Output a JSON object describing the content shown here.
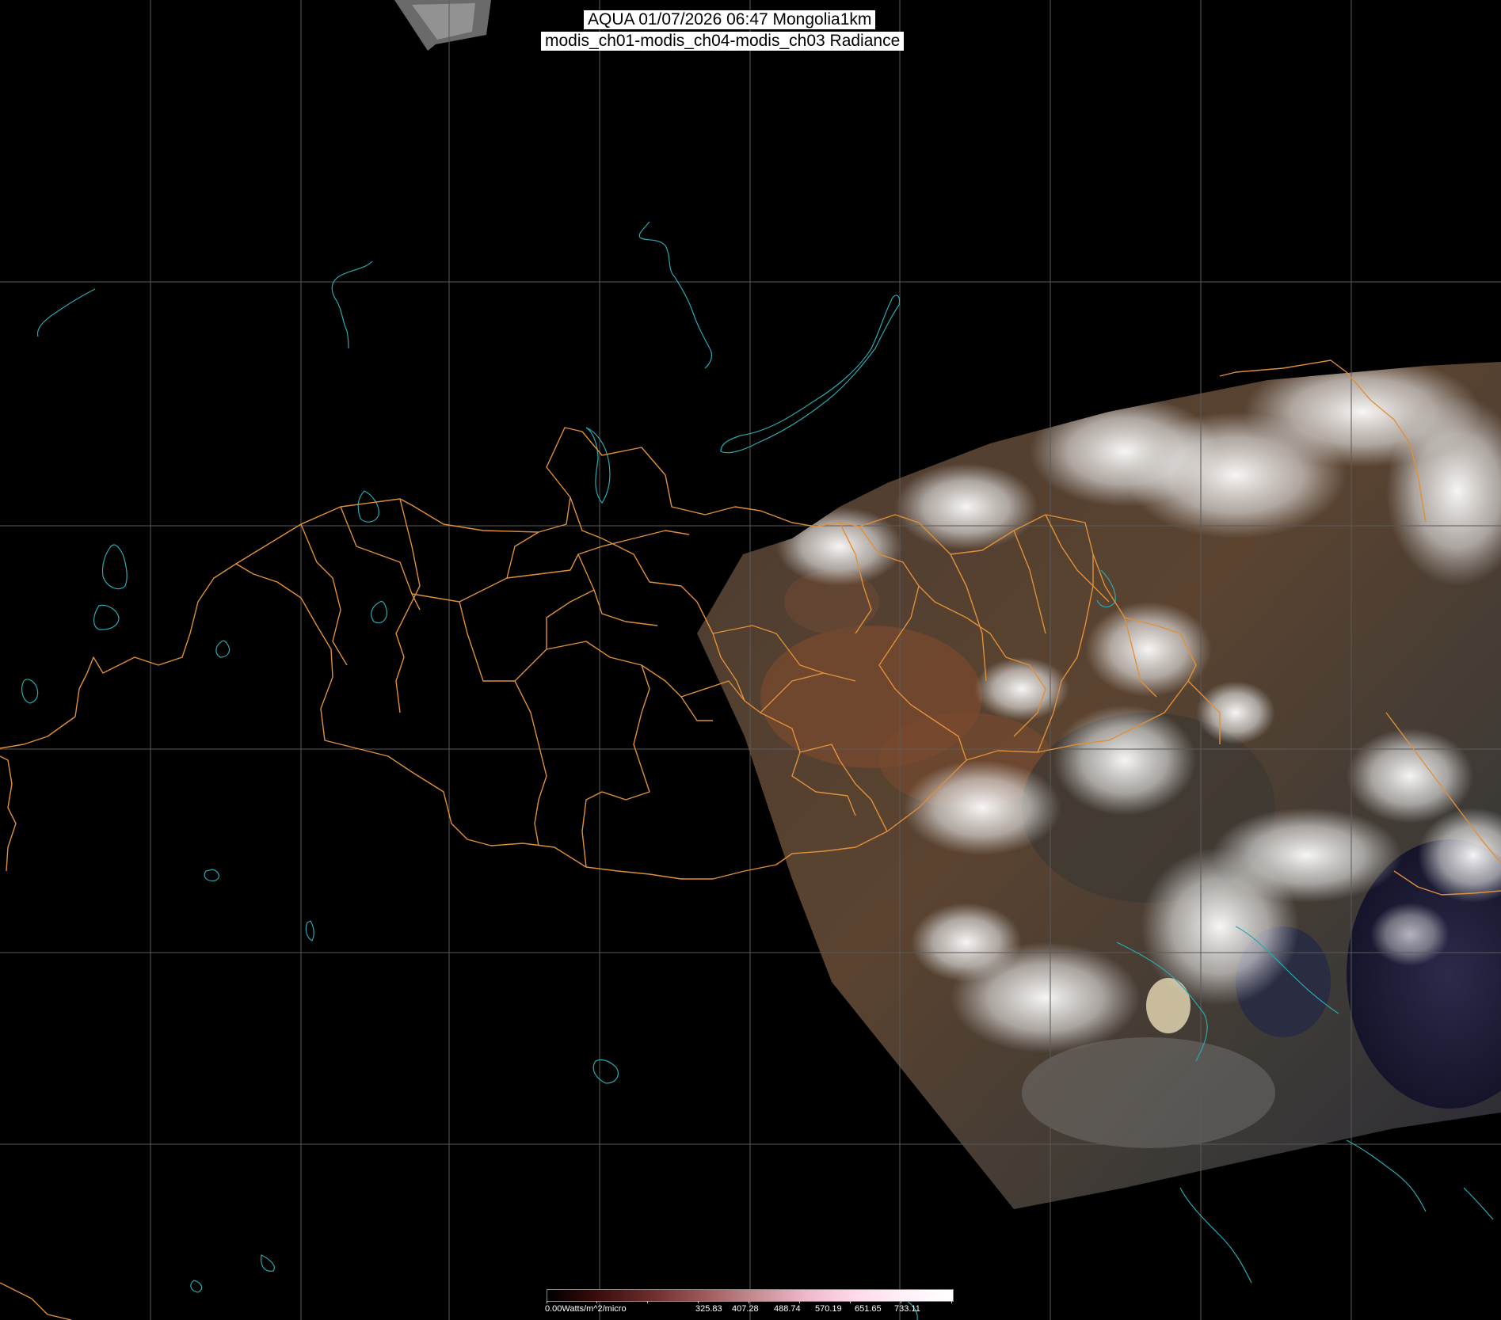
{
  "title": {
    "line1": "AQUA 01/07/2026 06:47 Mongolia1km",
    "line2": "modis_ch01-modis_ch04-modis_ch03 Radiance"
  },
  "colorbar": {
    "unit_label": "0.00Watts/m^2/micro",
    "tick_labels": [
      "325.83",
      "407.28",
      "488.74",
      "570.19",
      "651.65",
      "733.11"
    ]
  },
  "colors": {
    "background": "#000000",
    "graticule": "#5a5a5a",
    "admin_boundaries": "#e0903a",
    "coastlines_lakes": "#2aa9b0",
    "title_background": "#ffffff"
  }
}
